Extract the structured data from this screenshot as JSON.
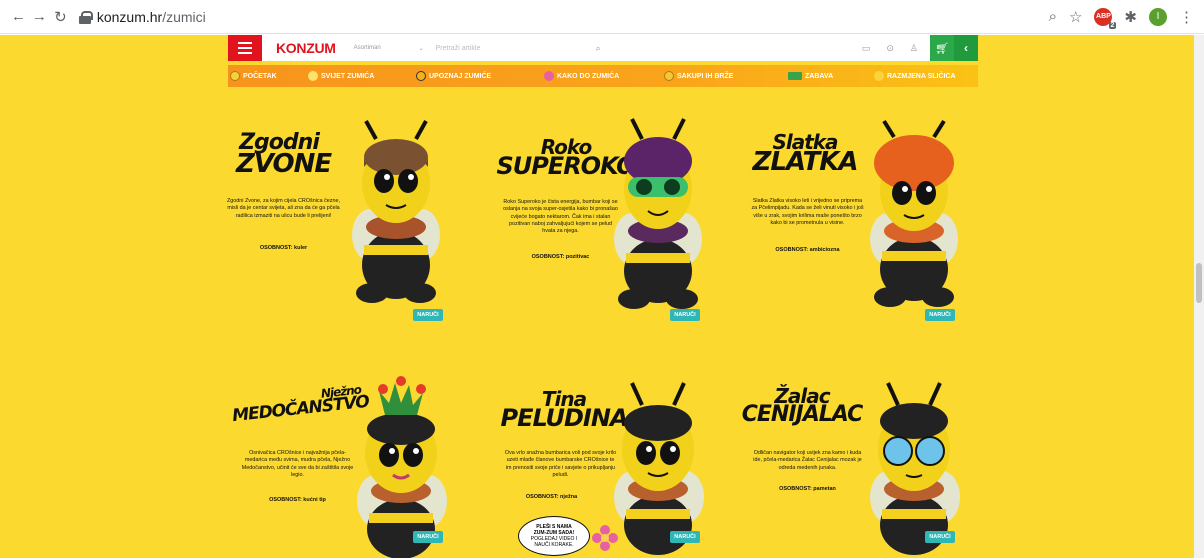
{
  "browser": {
    "url_domain": "konzum.hr",
    "url_path": "/zumici",
    "profile_initial": "I",
    "ext_badge_label": "ABP",
    "ext_badge_count": "2"
  },
  "header": {
    "logo": "KONZUM",
    "store_placeholder": "Asortiman",
    "search_placeholder": "Pretraži artikle"
  },
  "menu": [
    {
      "label": "POČETAK",
      "color": "#f5d23a"
    },
    {
      "label": "SVIJET ZUMIĆA",
      "color": "#fde36b"
    },
    {
      "label": "UPOZNAJ ZUMIĆE",
      "color": "#f3b11d"
    },
    {
      "label": "KAKO DO ZUMIĆA",
      "color": "#e85fa3"
    },
    {
      "label": "SAKUPI IH BRŽE",
      "color": "#f5c53a"
    },
    {
      "label": "ZABAVA",
      "color": "#3aa24a"
    },
    {
      "label": "RAZMJENA SLIČICA",
      "color": "#fbd33a"
    }
  ],
  "characters": [
    {
      "title_line1": "Zgodni",
      "title_line2": "ZVONE",
      "description": "Zgodni Zvone, za kojim cijela CROšnica čezne, misli da je centar svijeta, ali zna da će ga pčela radilica izmaziti na ulicu bude li prelijeni!",
      "trait": "OSOBNOST: kuler",
      "order": "NARUČI"
    },
    {
      "title_line1": "Roko",
      "title_line2": "SUPEROKO",
      "description": "Roko Superoko je čista energija, bumbar koji se oslanja na svoja super-osjetila kako bi pronašao cvijeće bogato nektarom. Čak ima i stalan pozitivan naboj zahvaljujući kojem se pelud hvata za njega.",
      "trait": "OSOBNOST: pozitivac",
      "order": "NARUČI"
    },
    {
      "title_line1": "Slatka",
      "title_line2": "ZLATKA",
      "description": "Slatka Zlatka visoko leti i vrijedno se priprema za Pčelimpijadu. Kada se želi vinuti visoko i još više u zrak, svojim krilima maše ponešto brzo kako bi se prometnula u visine.",
      "trait": "OSOBNOST: ambiciozna",
      "order": "NARUČI"
    },
    {
      "title_line1": "Nježno",
      "title_line2": "MEDOČANSTVO",
      "description": "Osnivačica CROšnice i najvažnija pčela-medarica među svima, mudra pčela, Nježno Medočanstvo, učinit će sve da bi zaštitila svoje legio.",
      "trait": "OSOBNOST: kućni tip",
      "order": "NARUČI"
    },
    {
      "title_line1": "Tina",
      "title_line2": "PELUDINA",
      "description": "Ova vrlo snažna bumbarica voli pod svoje krilo uzeti mlađe članove bumbarske CROšnice te im prenositi svoje priče i savjete o prikupljanju peludi.",
      "trait": "OSOBNOST: nježna",
      "order": "NARUČI"
    },
    {
      "title_line1": "Žalac",
      "title_line2": "CENIJALAC",
      "description": "Odličan navigator koji uvijek zna kamo i kuda ide, pčela-medarica Žalac Cenijalac mozak je odreda medenih junaka.",
      "trait": "OSOBNOST: pametan",
      "order": "NARUČI"
    }
  ],
  "bubble": {
    "line1": "PLEŠI S NAMA",
    "line2": "ZUM-ZUM SADA!",
    "line3": "POGLEDAJ VIDEO I",
    "line4": "NAUČI KORAKE."
  },
  "colors": {
    "page_bg": "#fcd92e",
    "brand_red": "#e1141e",
    "cart_green": "#2ba84a",
    "order_teal": "#2fb7b8"
  }
}
